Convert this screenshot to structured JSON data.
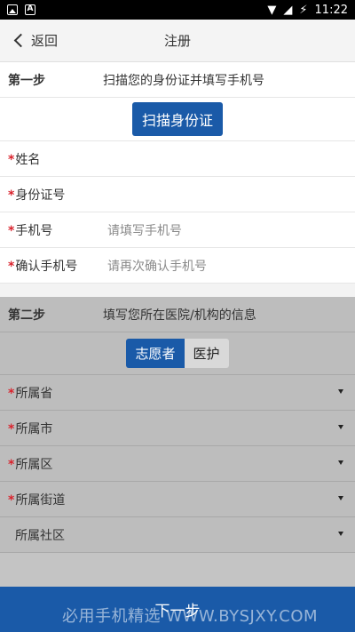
{
  "status_bar": {
    "time": "11:22",
    "battery": "⚡"
  },
  "nav": {
    "back_label": "返回",
    "title": "注册"
  },
  "step1": {
    "label": "第一步",
    "desc": "扫描您的身份证并填写手机号",
    "scan_button": "扫描身份证",
    "fields": [
      {
        "label": "姓名",
        "required": "*",
        "placeholder": ""
      },
      {
        "label": "身份证号",
        "required": "*",
        "placeholder": ""
      },
      {
        "label": "手机号",
        "required": "*",
        "placeholder": "请填写手机号"
      },
      {
        "label": "确认手机号",
        "required": "*",
        "placeholder": "请再次确认手机号"
      }
    ]
  },
  "step2": {
    "label": "第二步",
    "desc": "填写您所在医院/机构的信息",
    "toggle": {
      "selected": "志愿者",
      "other": "医护"
    },
    "dropdowns": [
      {
        "label": "所属省",
        "required": "*"
      },
      {
        "label": "所属市",
        "required": "*"
      },
      {
        "label": "所属区",
        "required": "*"
      },
      {
        "label": "所属街道",
        "required": "*"
      },
      {
        "label": "所属社区",
        "required": ""
      }
    ]
  },
  "next_button": "下一步",
  "watermark": "必用手机精选 WWW.BYSJXY.COM",
  "colors": {
    "primary": "#1a5aa8",
    "required": "#d9232d"
  }
}
